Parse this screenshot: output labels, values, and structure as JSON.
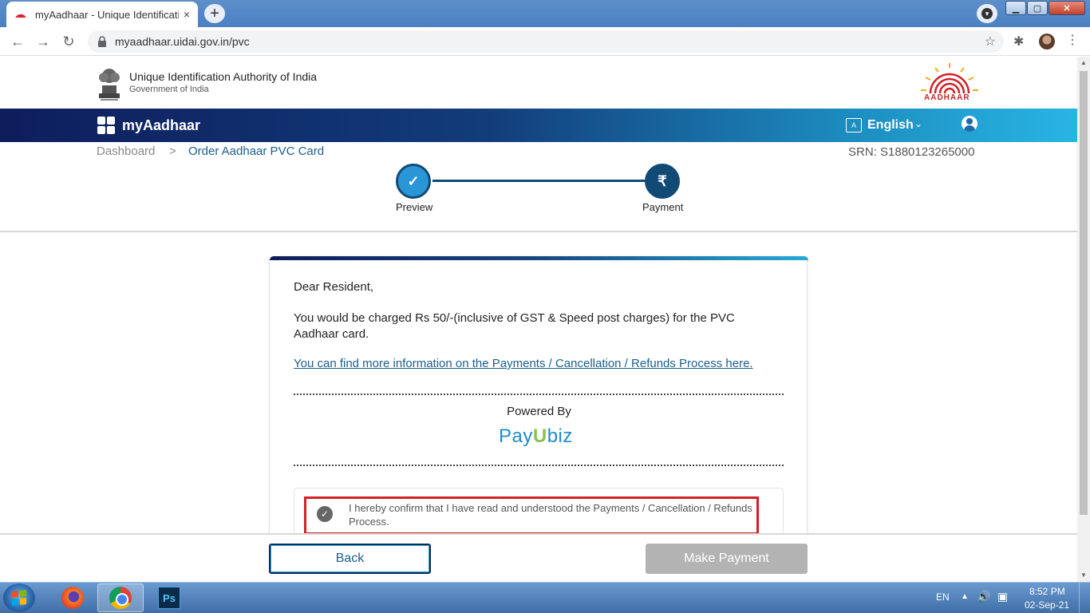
{
  "browser": {
    "tab_title": "myAadhaar - Unique Identificatio",
    "tab_close": "×",
    "new_tab": "+",
    "url": "myaadhaar.uidai.gov.in/pvc",
    "nav": {
      "back": "←",
      "forward": "→",
      "reload": "↻"
    },
    "star": "☆",
    "extensions": "✱",
    "menu": "⋮",
    "win_min": "▁",
    "win_max": "▢",
    "win_close": "✕"
  },
  "header": {
    "org_name": "Unique Identification Authority of India",
    "org_sub": "Government of India",
    "logo_text": "AADHAAR"
  },
  "navbar": {
    "app_name": "myAadhaar",
    "language": "English",
    "lang_caret": "⌄",
    "lang_icon_text": "A"
  },
  "breadcrumb": {
    "dashboard": "Dashboard",
    "separator": ">",
    "current": "Order Aadhaar PVC Card"
  },
  "srn": "SRN: S1880123265000",
  "steps": [
    {
      "label": "Preview",
      "icon": "✓",
      "state": "done"
    },
    {
      "label": "Payment",
      "icon": "₹",
      "state": "active"
    }
  ],
  "card": {
    "greeting": "Dear Resident,",
    "charge_text": "You would be charged Rs 50/-(inclusive of GST & Speed post charges) for the PVC Aadhaar card.",
    "info_link": "You can find more information on the Payments / Cancellation / Refunds Process here.",
    "powered_by": "Powered By",
    "payu_prefix": "Pay",
    "payu_mid": "U",
    "payu_suffix": "biz",
    "confirm_text": "I hereby confirm that I have read and understood the Payments / Cancellation / Refunds Process.",
    "confirm_check": "✓"
  },
  "actions": {
    "back": "Back",
    "make_payment": "Make Payment"
  },
  "taskbar": {
    "ps_label": "Ps",
    "lang": "EN",
    "tray_arrow": "▲",
    "volume": "🔊",
    "network": "▣",
    "time": "8:52 PM",
    "date": "02-Sep-21"
  },
  "colors": {
    "primary_dark": "#0e1d5c",
    "primary_light": "#27a9d6",
    "link": "#1b5e8c",
    "highlight_red": "#d41f26",
    "disabled_btn": "#b3b3b3"
  }
}
